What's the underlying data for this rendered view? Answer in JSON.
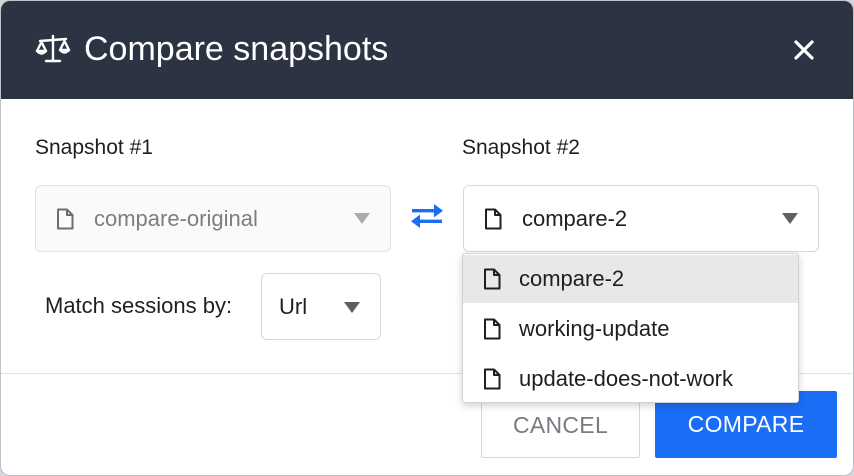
{
  "dialog": {
    "title": "Compare snapshots",
    "title_icon": "scale-icon",
    "close_icon": "close-icon"
  },
  "snapshot1": {
    "label": "Snapshot #1",
    "value": "compare-original",
    "disabled": true,
    "icon": "document-icon"
  },
  "swap": {
    "icon": "swap-arrows-icon",
    "color": "#1a6ef5"
  },
  "snapshot2": {
    "label": "Snapshot #2",
    "value": "compare-2",
    "icon": "document-icon",
    "open": true,
    "options": [
      {
        "label": "compare-2",
        "selected": true
      },
      {
        "label": "working-update",
        "selected": false
      },
      {
        "label": "update-does-not-work",
        "selected": false
      }
    ]
  },
  "match": {
    "label": "Match sessions by:",
    "value": "Url"
  },
  "buttons": {
    "cancel_label": "CANCEL",
    "compare_label": "COMPARE"
  },
  "colors": {
    "header_bg": "#2c3443",
    "primary": "#1a6ef5",
    "selected_option_bg": "#e8e8e8"
  }
}
